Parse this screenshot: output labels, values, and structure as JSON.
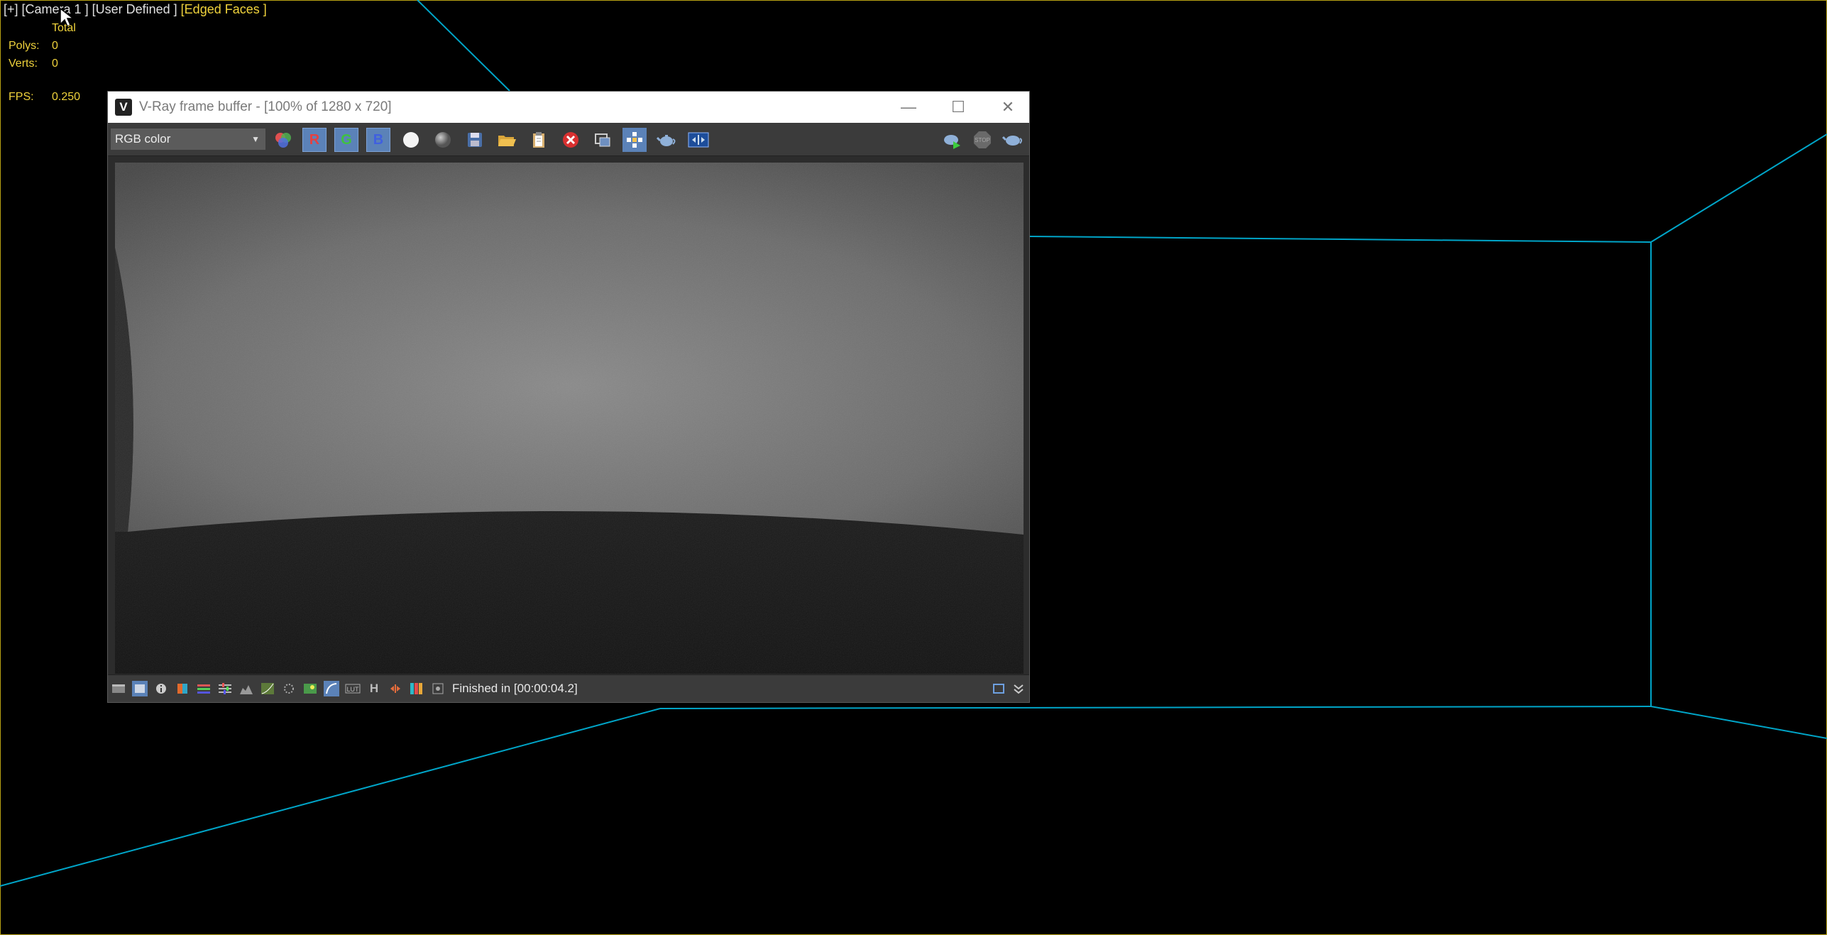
{
  "viewport": {
    "label_plus": "[+]",
    "label_camera": "[Camera 1 ]",
    "label_user": "[User Defined ]",
    "label_shading": "[Edged Faces ]",
    "stats": {
      "total_label": "Total",
      "polys_label": "Polys:",
      "polys_value": "0",
      "verts_label": "Verts:",
      "verts_value": "0",
      "fps_label": "FPS:",
      "fps_value": "0.250"
    },
    "colors": {
      "wire": "#00a5c8",
      "border": "#b8a214",
      "text": "#f0d33c"
    }
  },
  "vfb": {
    "title": "V-Ray frame buffer - [100% of 1280 x 720]",
    "logo": "V",
    "window_buttons": {
      "minimize": "—",
      "maximize": "☐",
      "close": "✕"
    },
    "channel": "RGB color",
    "channel_arrow": "▼",
    "toolbar": {
      "r": "R",
      "g": "G",
      "b": "B",
      "stop_label": "STOP"
    },
    "icons": [
      "color-picker-icon",
      "red-channel-icon",
      "green-channel-icon",
      "blue-channel-icon",
      "white-circle-icon",
      "grey-circle-icon",
      "save-icon",
      "open-folder-icon",
      "clipboard-icon",
      "clear-icon",
      "region-icon",
      "track-mouse-icon",
      "teapot-icon",
      "lens-effects-icon",
      "render-interactive-icon",
      "stop-render-icon",
      "render-icon"
    ],
    "status": {
      "text": "Finished in [00:00:04.2]",
      "lut_label": "LUT",
      "h_label": "H"
    }
  }
}
